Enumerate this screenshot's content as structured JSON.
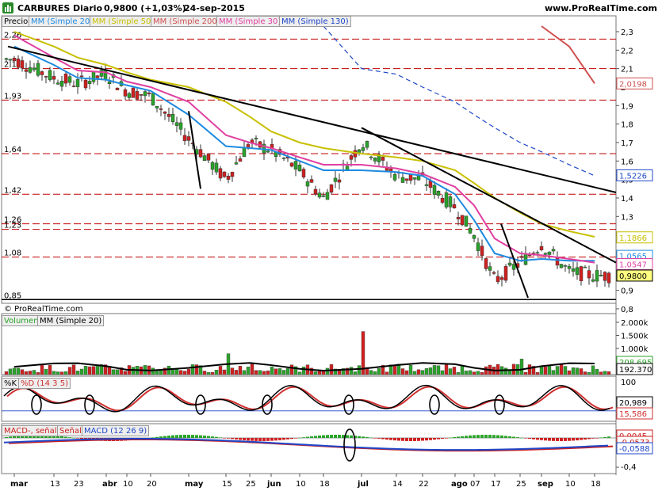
{
  "header": {
    "ticker": "CARBURES",
    "period": "Diario",
    "last": "0,9800 (+1,03%)",
    "date": "24-sep-2015",
    "site": "www.ProRealTime.com"
  },
  "price_panel": {
    "legend": {
      "price": "Precio",
      "ma20": "MM (Simple 20)",
      "ma50": "MM (Simple 50)",
      "ma200": "MM (Simple 200)",
      "ma30": "MM (Simple 30)",
      "ma130": "MM (Simple 130)"
    },
    "copyright": "© ProRealTime.com",
    "left_levels": [
      "2,26",
      "2,1",
      "1,93",
      "1,64",
      "1,42",
      "1,26",
      "1,23",
      "1,08",
      "0,85"
    ],
    "right_ticks": [
      "2,3",
      "2,2",
      "2,1",
      "2",
      "1,9",
      "1,8",
      "1,7",
      "1,6",
      "1,5",
      "1,4",
      "1,3",
      "1,2",
      "1,1",
      "1",
      "0,9",
      "0,8"
    ],
    "value_flags": [
      {
        "text": "2,0198",
        "color": "#d05050"
      },
      {
        "text": "1,5226",
        "color": "#1f47c8"
      },
      {
        "text": "1,1866",
        "color": "#c8c000"
      },
      {
        "text": "1,0565",
        "color": "#1f8ae0"
      },
      {
        "text": "1,0547",
        "color": "#e040a0"
      },
      {
        "text": "0,9800",
        "color": "#000000"
      }
    ]
  },
  "volume_panel": {
    "legend": {
      "volume": "Volumen",
      "ma": "MM (Simple 20)"
    },
    "right_ticks": [
      "2.000k",
      "1.500k",
      "1.000k",
      "500k"
    ],
    "value_flags": [
      {
        "text": "208.695",
        "color": "#2aa32a"
      },
      {
        "text": "192.370",
        "color": "#000000"
      }
    ]
  },
  "stoch_panel": {
    "legend": {
      "k": "%K",
      "d": "%D (14 3 5)"
    },
    "right_ticks": [
      "100"
    ],
    "value_flags": [
      {
        "text": "20,989",
        "color": "#000000"
      },
      {
        "text": "15,586",
        "color": "#d03030"
      }
    ]
  },
  "macd_panel": {
    "legend": {
      "macd": "MACD-, señal",
      "signal": "Señal",
      "line": "MACD (12 26 9)"
    },
    "right_ticks": [
      "-0,4"
    ],
    "value_flags": [
      {
        "text": "0,0045",
        "color": "#cc2020"
      },
      {
        "text": "-0,0573",
        "color": "#cc2020"
      },
      {
        "text": "-0,0588",
        "color": "#1f47c8"
      }
    ]
  },
  "x_axis": {
    "labels": [
      "mar",
      "13",
      "23",
      "abr",
      "10",
      "20",
      "may",
      "15",
      "25",
      "jun",
      "10",
      "18",
      "jul",
      "14",
      "22",
      "ago",
      "07",
      "17",
      "25",
      "sep",
      "10",
      "18"
    ]
  },
  "colors": {
    "up": "#2aa32a",
    "down": "#d02020",
    "ma20": "#1f8ae0",
    "ma50": "#c8c000",
    "ma200": "#d05050",
    "ma30": "#e040a0",
    "ma130": "#1f47c8",
    "level": "#c00000"
  },
  "chart_data": {
    "type": "line",
    "title": "CARBURES Diario",
    "ylim": [
      0.8,
      2.35
    ],
    "x": [
      "mar",
      "13",
      "23",
      "abr",
      "10",
      "20",
      "may",
      "15",
      "25",
      "jun",
      "10",
      "18",
      "jul",
      "14",
      "22",
      "ago",
      "07",
      "17",
      "25",
      "sep",
      "10",
      "18"
    ],
    "series": [
      {
        "name": "Precio",
        "values": [
          2.15,
          2.05,
          2.02,
          2.07,
          1.98,
          1.95,
          1.72,
          1.5,
          1.7,
          1.66,
          1.55,
          1.4,
          1.7,
          1.52,
          1.5,
          1.35,
          1.2,
          0.95,
          1.05,
          1.15,
          1.0,
          0.98
        ]
      },
      {
        "name": "MM (Simple 20)",
        "values": [
          2.22,
          2.12,
          2.05,
          2.04,
          2.01,
          1.98,
          1.85,
          1.68,
          1.67,
          1.66,
          1.6,
          1.55,
          1.55,
          1.54,
          1.52,
          1.42,
          1.28,
          1.1,
          1.06,
          1.07,
          1.06,
          1.06
        ]
      },
      {
        "name": "MM (Simple 50)",
        "values": [
          2.3,
          2.22,
          2.16,
          2.12,
          2.08,
          2.04,
          2.0,
          1.92,
          1.84,
          1.76,
          1.7,
          1.67,
          1.64,
          1.62,
          1.6,
          1.55,
          1.48,
          1.4,
          1.32,
          1.26,
          1.22,
          1.19
        ]
      },
      {
        "name": "MM (Simple 200)",
        "values": [
          null,
          null,
          null,
          null,
          null,
          null,
          null,
          null,
          null,
          null,
          null,
          null,
          null,
          null,
          null,
          null,
          null,
          null,
          null,
          2.33,
          2.22,
          2.02
        ]
      },
      {
        "name": "MM (Simple 30)",
        "values": [
          2.28,
          2.16,
          2.09,
          2.08,
          2.03,
          2.0,
          1.92,
          1.74,
          1.7,
          1.67,
          1.62,
          1.58,
          1.58,
          1.56,
          1.53,
          1.46,
          1.36,
          1.18,
          1.1,
          1.09,
          1.07,
          1.05
        ]
      },
      {
        "name": "MM (Simple 130)",
        "values": [
          null,
          null,
          null,
          null,
          null,
          null,
          null,
          null,
          null,
          null,
          null,
          2.33,
          2.1,
          2.07,
          2.0,
          1.92,
          1.85,
          1.78,
          1.7,
          1.65,
          1.58,
          1.52
        ]
      }
    ],
    "volume": [
      250,
      900,
      300,
      400,
      350,
      250,
      300,
      800,
      400,
      300,
      250,
      350,
      1650,
      400,
      300,
      1200,
      300,
      900,
      600,
      350,
      250,
      208.695
    ]
  }
}
